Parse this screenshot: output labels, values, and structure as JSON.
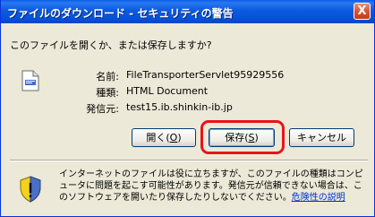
{
  "window": {
    "title": "ファイルのダウンロード - セキュリティの警告",
    "close_glyph": "X"
  },
  "prompt": "このファイルを開くか、または保存しますか?",
  "file_info": {
    "name_label": "名前:",
    "name_value": "FileTransporterServlet95929556",
    "type_label": "種類:",
    "type_value": "HTML Document",
    "source_label": "発信元:",
    "source_value": "test15.ib.shinkin-ib.jp"
  },
  "buttons": {
    "open": {
      "text": "開く(",
      "key": "O",
      "end": ")"
    },
    "save": {
      "text": "保存(",
      "key": "S",
      "end": ")"
    },
    "cancel": "キャンセル"
  },
  "warning": {
    "text": "インターネットのファイルは役に立ちますが、このファイルの種類はコンピュータに問題を起こす可能性があります。発信元が信頼できない場合は、このソフトウェアを開いたり保存したりしないでください。",
    "link": "危険性の説明"
  },
  "colors": {
    "highlight": "#e8141b",
    "titlebar": "#0a5ee8",
    "dialog_bg": "#ece9d8"
  },
  "icons": [
    "close-icon",
    "html-file-icon",
    "security-shield-icon"
  ]
}
